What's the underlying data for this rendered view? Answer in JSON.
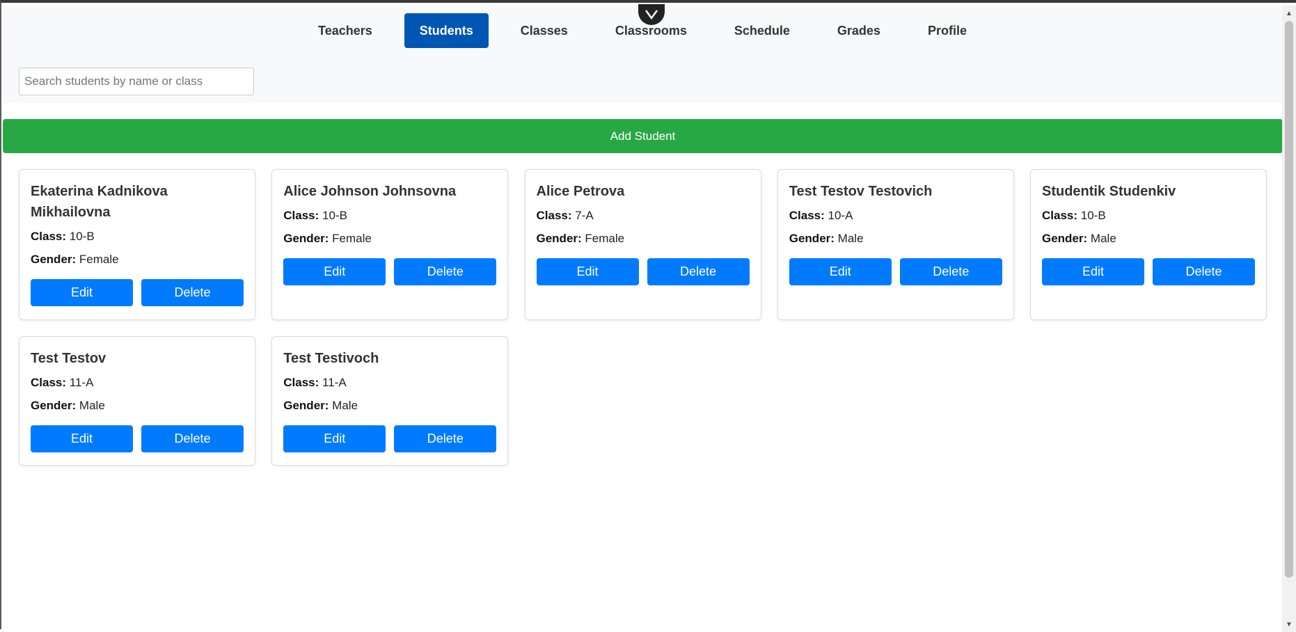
{
  "nav": {
    "items": [
      {
        "label": "Teachers",
        "active": false
      },
      {
        "label": "Students",
        "active": true
      },
      {
        "label": "Classes",
        "active": false
      },
      {
        "label": "Classrooms",
        "active": false
      },
      {
        "label": "Schedule",
        "active": false
      },
      {
        "label": "Grades",
        "active": false
      },
      {
        "label": "Profile",
        "active": false
      }
    ]
  },
  "search": {
    "placeholder": "Search students by name or class",
    "value": ""
  },
  "add_button": {
    "label": "Add Student"
  },
  "labels": {
    "class": "Class:",
    "gender": "Gender:",
    "edit": "Edit",
    "delete": "Delete"
  },
  "students": [
    {
      "name": "Ekaterina Kadnikova Mikhailovna",
      "class": "10-B",
      "gender": "Female"
    },
    {
      "name": "Alice Johnson Johnsovna",
      "class": "10-B",
      "gender": "Female"
    },
    {
      "name": "Alice Petrova",
      "class": "7-A",
      "gender": "Female"
    },
    {
      "name": "Test Testov Testovich",
      "class": "10-A",
      "gender": "Male"
    },
    {
      "name": "Studentik Studenkiv",
      "class": "10-B",
      "gender": "Male"
    },
    {
      "name": "Test Testov",
      "class": "11-A",
      "gender": "Male"
    },
    {
      "name": "Test Testivoch",
      "class": "11-A",
      "gender": "Male"
    }
  ],
  "colors": {
    "primary": "#007bff",
    "active_nav": "#0056b3",
    "success": "#28a745"
  }
}
